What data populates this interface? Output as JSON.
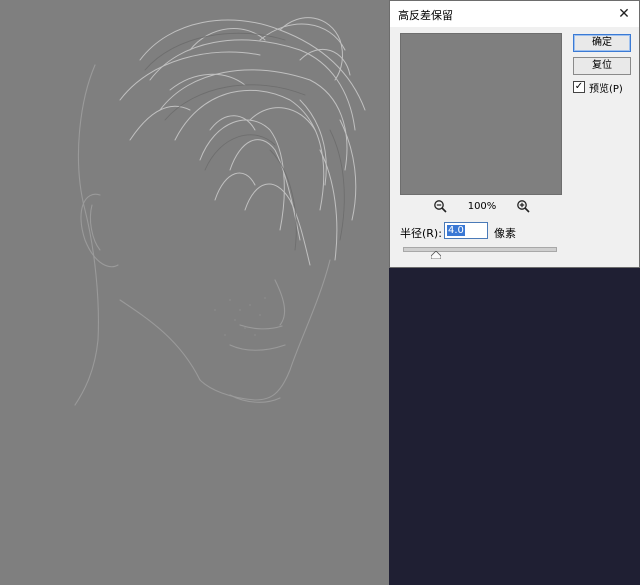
{
  "dialog": {
    "title": "高反差保留",
    "ok_label": "确定",
    "reset_label": "复位",
    "preview_label": "预览(P)",
    "preview_checked": true,
    "zoom": "100%",
    "radius_label": "半径(R):",
    "radius_value": "4.0",
    "radius_unit": "像素",
    "close_glyph": "✕"
  },
  "canvas": {
    "background_color": "#7f7f7f",
    "content": "high-pass-filtered-portrait"
  },
  "colors": {
    "workspace_dark": "#1f1f33",
    "dialog_bg": "#f0f0f0",
    "accent": "#3b7ad4"
  }
}
